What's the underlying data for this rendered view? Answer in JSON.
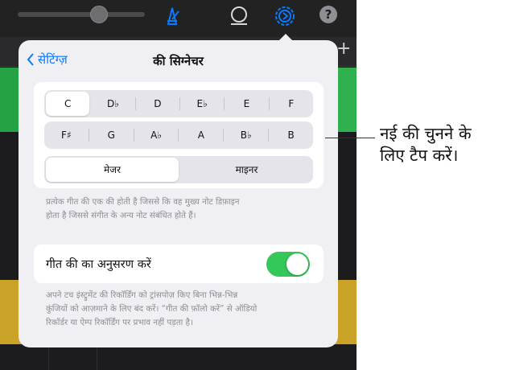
{
  "popover": {
    "back_label": "सेटिंग्ज़",
    "title": "की सिग्नेचर",
    "keys_row1": [
      "C",
      "D♭",
      "D",
      "E♭",
      "E",
      "F"
    ],
    "keys_row2": [
      "F♯",
      "G",
      "A♭",
      "A",
      "B♭",
      "B"
    ],
    "selected_key": "C",
    "modes": [
      "मेजर",
      "माइनर"
    ],
    "selected_mode": "मेजर",
    "key_description_line1": "प्रत्येक गीत की एक की होती है जिससे कि वह मुख्य नोट डिफ़ाइन",
    "key_description_line2": "होता है जिससे संगीत के अन्य नोट संबंधित होते हैं।",
    "follow_label": "गीत की का अनुसरण करें",
    "follow_enabled": true,
    "follow_description_line1": "अपने टच इंस्ट्रुमेंट की रिकॉर्डिंग को ट्रांसपोज़ किए बिना भिन्न-भिन्न",
    "follow_description_line2": "कुंजियों को आज़माने के लिए बंद करें। “गीत की फ़ॉलो करें” से ऑडियो",
    "follow_description_line3": "रिकॉर्डर या ऐम्प रिकॉर्डिंग पर प्रभाव नहीं पड़ता है।"
  },
  "callout": {
    "line1": "नई की चुनने के",
    "line2": "लिए टैप करें।"
  },
  "toolbar": {
    "help_label": "?"
  },
  "icons": [
    "metronome-icon",
    "loop-icon",
    "settings-gear-icon",
    "help-icon",
    "add-track-icon"
  ],
  "colors": {
    "accent": "#0a7aff",
    "toggle_on": "#34c759",
    "track_green": "#25a244",
    "track_yellow": "#c9a227"
  }
}
